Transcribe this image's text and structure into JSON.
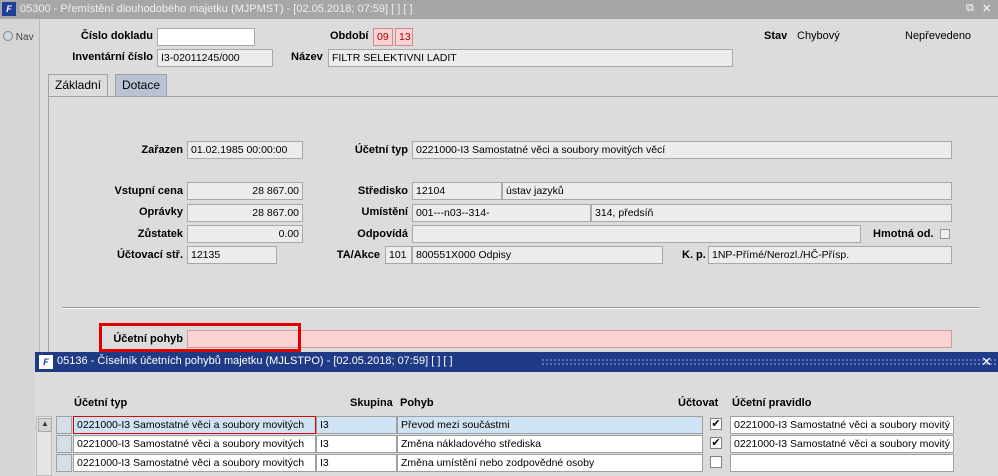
{
  "window": {
    "title": "05300 - Přemístění dlouhodobého majetku (MJPMST) - [02.05.2018; 07:59]  [ ]  [ ]",
    "logo": "F",
    "restore_icon": "restore-icon",
    "close_icon": "close-icon"
  },
  "nav": {
    "label": "Nav"
  },
  "header": {
    "cislo_dokladu_label": "Číslo dokladu",
    "cislo_dokladu_value": "",
    "obdobi_label": "Období",
    "obdobi_month": "09",
    "obdobi_year": "13",
    "stav_label": "Stav",
    "stav_value": "Chybový",
    "stav_note": "Nepřevedeno",
    "inventarni_label": "Inventární číslo",
    "inventarni_value": "I3-02011245/000",
    "nazev_label": "Název",
    "nazev_value": "FILTR SELEKTIVNI LADIT"
  },
  "tabs": [
    {
      "label": "Základní",
      "active": true
    },
    {
      "label": "Dotace",
      "active": false
    }
  ],
  "form": {
    "zarazen_label": "Zařazen",
    "zarazen_value": "01.02.1985 00:00:00",
    "ucetni_typ_label": "Účetní typ",
    "ucetni_typ_value": "0221000-I3 Samostatné věci a soubory movitých věcí",
    "vstupni_cena_label": "Vstupní cena",
    "vstupni_cena_value": "28 867.00",
    "opravky_label": "Oprávky",
    "opravky_value": "28 867.00",
    "zustatek_label": "Zůstatek",
    "zustatek_value": "0.00",
    "uctovaci_str_label": "Účtovací stř.",
    "uctovaci_str_value": "12135",
    "stredisko_label": "Středisko",
    "stredisko_code": "12104",
    "stredisko_name": "ústav jazyků",
    "umisteni_label": "Umístění",
    "umisteni_code": "001---n03--314-",
    "umisteni_name": "314, předsíň",
    "odpovida_label": "Odpovídá",
    "odpovida_value": "",
    "hmotna_label": "Hmotná od.",
    "ta_akce_label": "TA/Akce",
    "ta_akce_code": "101",
    "ta_akce_value": "800551X000 Odpisy",
    "kp_label": "K. p.",
    "kp_value": "1NP-Přímé/Nerozl./HČ-Přísp.",
    "ucetni_pohyb_label": "Účetní pohyb",
    "ucetni_pohyb_value": ""
  },
  "lov": {
    "title": "05136 - Číselník účetních pohybů majetku (MJLSTPO) - [02.05.2018; 07:59]  [ ]  [ ]",
    "logo": "F",
    "close_icon": "close-icon",
    "columns": {
      "ucetni_typ": "Účetní typ",
      "skupina": "Skupina",
      "pohyb": "Pohyb",
      "uctovat": "Účtovat",
      "ucetni_pravidlo": "Účetní pravidlo"
    },
    "rows": [
      {
        "ucetni_typ": "0221000-I3 Samostatné věci a soubory movitých",
        "skupina": "I3",
        "pohyb": "Převod mezi součástmi",
        "uctovat": "✔",
        "ucetni_pravidlo": "0221000-I3 Samostatné věci a soubory movitý"
      },
      {
        "ucetni_typ": "0221000-I3 Samostatné věci a soubory movitých",
        "skupina": "I3",
        "pohyb": "Změna nákladového střediska",
        "uctovat": "✔",
        "ucetni_pravidlo": "0221000-I3 Samostatné věci a soubory movitý"
      },
      {
        "ucetni_typ": "0221000-I3 Samostatné věci a soubory movitých",
        "skupina": "I3",
        "pohyb": "Změna umístění nebo zodpovědné osoby",
        "uctovat": "",
        "ucetni_pravidlo": ""
      }
    ]
  }
}
